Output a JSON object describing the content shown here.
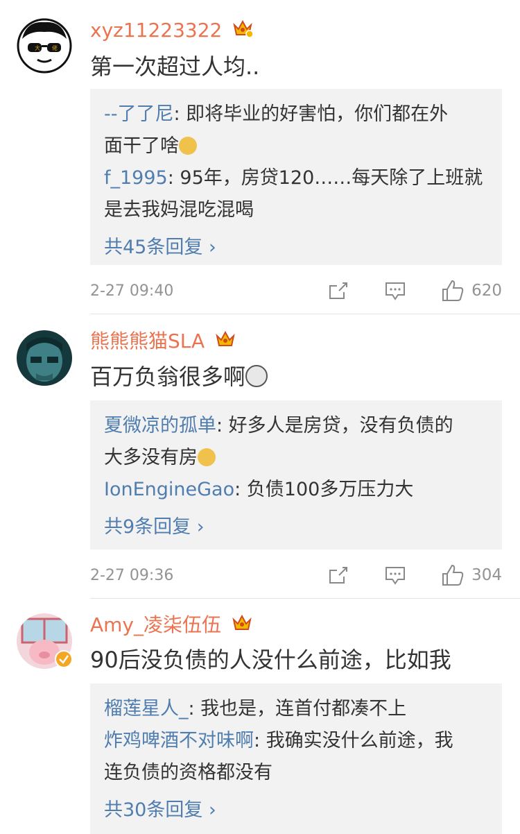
{
  "comments": [
    {
      "username": "xyz11223322",
      "text": "第一次超过人均..",
      "replies": [
        {
          "name": "--了了尼",
          "text": ": 即将毕业的好害怕，你们都在外",
          "text2": "面干了啥"
        },
        {
          "name": "f_1995",
          "text": ": 95年，房贷120……每天除了上班就",
          "text2": "是去我妈混吃混喝"
        }
      ],
      "more": "共45条回复 ›",
      "time": "2-27 09:40",
      "likes": "620"
    },
    {
      "username": "熊熊熊猫SLA",
      "text": "百万负翁很多啊",
      "replies": [
        {
          "name": "夏微凉的孤单",
          "text": ": 好多人是房贷，没有负债的",
          "text2": "大多没有房"
        },
        {
          "name": "IonEngineGao",
          "text": ": 负债100多万压力大",
          "text2": ""
        }
      ],
      "more": "共9条回复 ›",
      "time": "2-27 09:36",
      "likes": "304"
    },
    {
      "username": "Amy_凌柒伍伍",
      "text": "90后没负债的人没什么前途，比如我",
      "replies": [
        {
          "name": "榴莲星人_",
          "text": ": 我也是，连首付都凑不上",
          "text2": ""
        },
        {
          "name": "炸鸡啤酒不对味啊",
          "text": ": 我确实没什么前途，我",
          "text2": "连负债的资格都没有"
        }
      ],
      "more": "共30条回复 ›"
    }
  ],
  "colors": {
    "username": "#eb7350",
    "link": "#507daf",
    "meta": "#939393",
    "reply_bg": "#f2f2f2"
  },
  "icons": [
    "crown-badge-icon",
    "share-icon",
    "comment-icon",
    "like-icon",
    "verified-icon"
  ]
}
